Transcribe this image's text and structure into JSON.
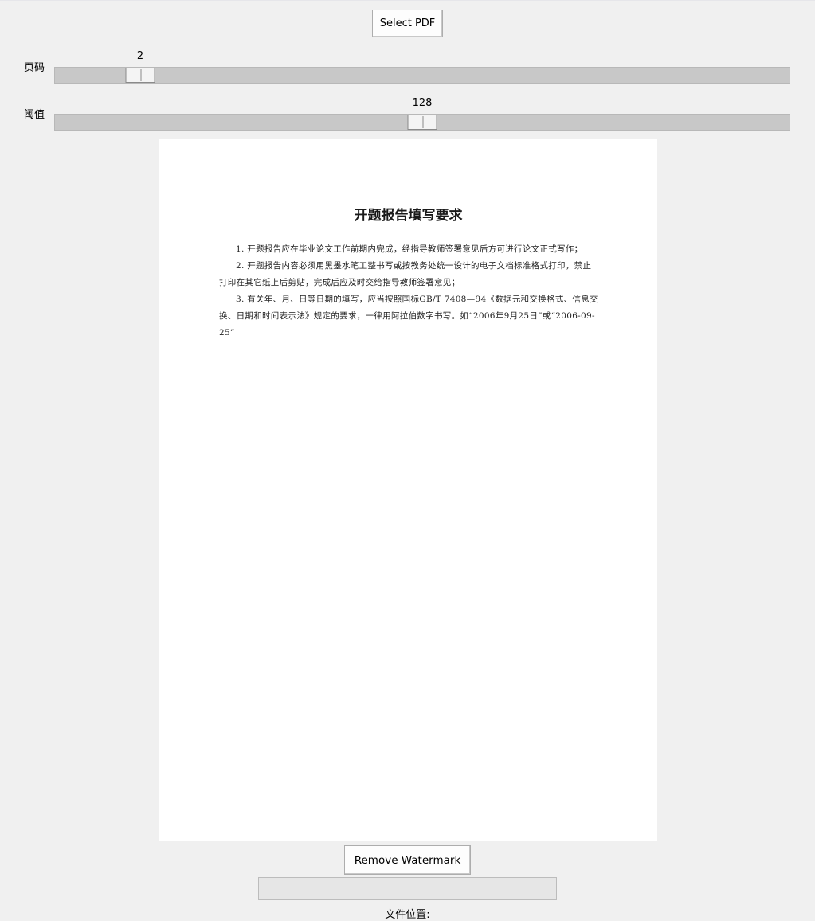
{
  "toolbar": {
    "select_pdf_label": "Select PDF"
  },
  "page_scale": {
    "label": "页码",
    "value": "2",
    "fraction": 0.1
  },
  "threshold_scale": {
    "label": "阈值",
    "value": "128",
    "fraction": 0.5
  },
  "preview": {
    "title": "开题报告填写要求",
    "paragraphs": [
      "1. 开题报告应在毕业论文工作前期内完成，经指导教师签署意见后方可进行论文正式写作；",
      "2. 开题报告内容必须用黑墨水笔工整书写或按教务处统一设计的电子文档标准格式打印，禁止打印在其它纸上后剪贴，完成后应及时交给指导教师签署意见；",
      "3. 有关年、月、日等日期的填写，应当按照国标GB/T 7408—94《数据元和交换格式、信息交换、日期和时间表示法》规定的要求，一律用阿拉伯数字书写。如“2006年9月25日”或“2006-09-25”"
    ]
  },
  "actions": {
    "remove_watermark_label": "Remove Watermark"
  },
  "progress": {
    "fraction": 0
  },
  "status": {
    "file_location_label": "文件位置:"
  }
}
